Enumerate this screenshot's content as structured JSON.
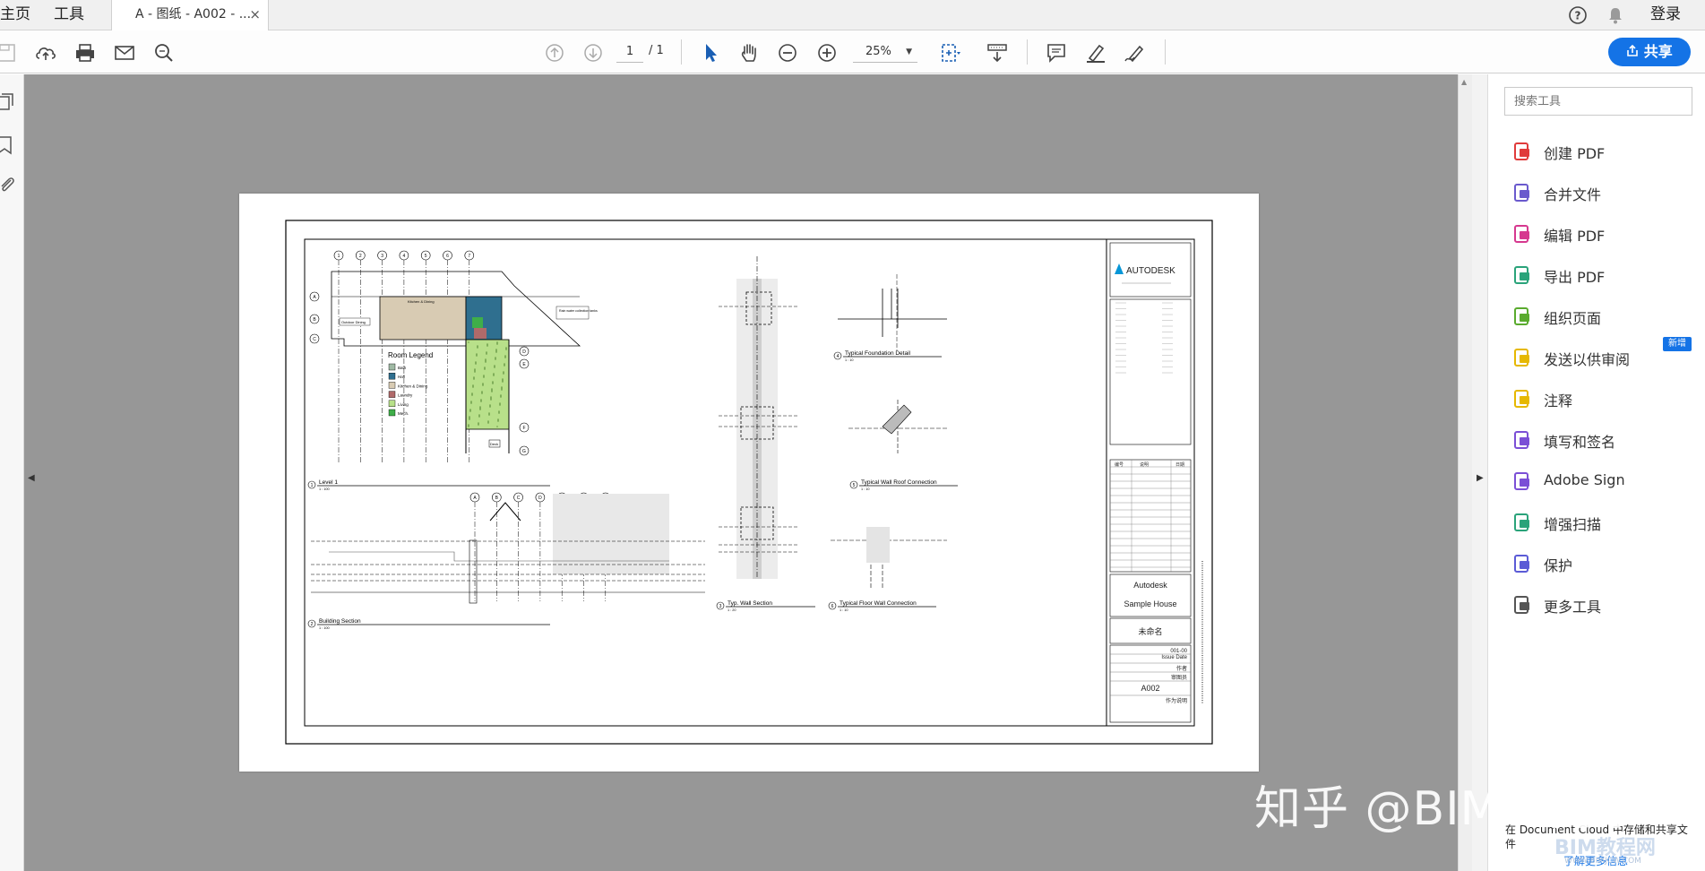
{
  "nav": {
    "home": "主页",
    "tools": "工具"
  },
  "tab": {
    "title": "A - 图纸 - A002 - ...",
    "close": "×"
  },
  "header_right": {
    "help": "?",
    "login": "登录"
  },
  "toolbar": {
    "page_current": "1",
    "page_total": "/ 1",
    "zoom": "25%",
    "share": "共享"
  },
  "tools_pane": {
    "search_placeholder": "搜索工具",
    "items": [
      {
        "label": "创建 PDF",
        "icon": "create-pdf-icon",
        "color": "#e03b3b"
      },
      {
        "label": "合并文件",
        "icon": "combine-files-icon",
        "color": "#6a5acd"
      },
      {
        "label": "编辑 PDF",
        "icon": "edit-pdf-icon",
        "color": "#d6388f"
      },
      {
        "label": "导出 PDF",
        "icon": "export-pdf-icon",
        "color": "#2aa37a"
      },
      {
        "label": "组织页面",
        "icon": "organize-pages-icon",
        "color": "#5aab2e"
      },
      {
        "label": "发送以供审阅",
        "icon": "send-for-review-icon",
        "color": "#e6b800"
      },
      {
        "label": "注释",
        "icon": "comment-icon",
        "color": "#e6b800"
      },
      {
        "label": "填写和签名",
        "icon": "fill-sign-icon",
        "color": "#7b4fd6"
      },
      {
        "label": "Adobe Sign",
        "icon": "adobe-sign-icon",
        "color": "#7b4fd6"
      },
      {
        "label": "增强扫描",
        "icon": "enhance-scan-icon",
        "color": "#2aa37a"
      },
      {
        "label": "保护",
        "icon": "protect-icon",
        "color": "#5b5bd6"
      },
      {
        "label": "更多工具",
        "icon": "more-tools-icon",
        "color": "#555555"
      }
    ],
    "new_badge": "新增",
    "document_cloud": "在 Document Cloud 中存储和共享文件",
    "learn_more": "了解更多信息"
  },
  "drawing": {
    "title_block": {
      "logo": "AUTODESK",
      "company": "Autodesk",
      "project": "Sample House",
      "unnamed": "未命名",
      "sheet": "A002",
      "project_no": "001-00",
      "issue_date": "Issue Date",
      "author": "作者",
      "reviewer": "审图员",
      "stamp": "作为说明",
      "rev_headers": [
        "编号",
        "说明",
        "日期"
      ]
    },
    "views": [
      {
        "num": "1",
        "title": "Level 1",
        "scale": "1 : 100"
      },
      {
        "num": "2",
        "title": "Building Section",
        "scale": "1 : 100"
      },
      {
        "num": "3",
        "title": "Typ. Wall Section",
        "scale": "1 : 20"
      },
      {
        "num": "4",
        "title": "Typical Foundation Detail",
        "scale": "1 : 10"
      },
      {
        "num": "5",
        "title": "Typical Wall Roof Connection",
        "scale": "1 : 10"
      },
      {
        "num": "6",
        "title": "Typical Floor Wall Connection",
        "scale": "1 : 10"
      }
    ],
    "room_legend": {
      "title": "Room Legend",
      "items": [
        {
          "label": "Bath",
          "color": "#9fb9a4"
        },
        {
          "label": "Hall",
          "color": "#2f6f8f"
        },
        {
          "label": "Kitchen & Dining",
          "color": "#d8cbb3"
        },
        {
          "label": "Laundry",
          "color": "#b06a6a"
        },
        {
          "label": "Living",
          "color": "#b8e08a"
        },
        {
          "label": "Mech.",
          "color": "#3fae49"
        }
      ]
    },
    "plan_labels": {
      "outdoor": "Outdoor Dining",
      "kitchen": "Kitchen & Dining",
      "rain": "Rain water collection tanks",
      "deck": "Deck"
    },
    "grid_numbers": [
      "1",
      "2",
      "3",
      "4",
      "5",
      "6",
      "7"
    ],
    "grid_letters": [
      "A",
      "B",
      "C",
      "D",
      "E",
      "F",
      "G"
    ]
  },
  "watermark": {
    "main": "知乎 @BIM二狗子",
    "site": "BIM教程网",
    "url": "WWW.BIMJCW.COM"
  }
}
